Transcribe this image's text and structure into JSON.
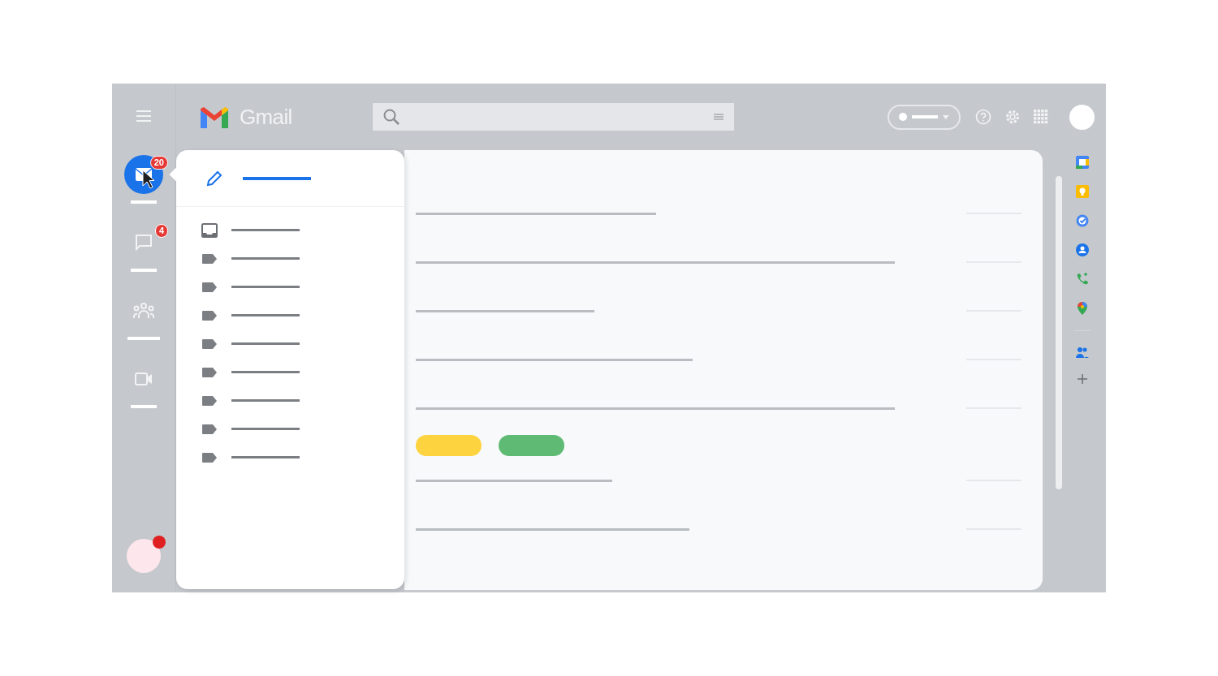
{
  "header": {
    "title": "Gmail"
  },
  "rail": [
    {
      "kind": "mail",
      "selected": true,
      "badge": "20"
    },
    {
      "kind": "chat",
      "selected": false,
      "badge": "4"
    },
    {
      "kind": "spaces",
      "selected": false
    },
    {
      "kind": "meet",
      "selected": false
    }
  ],
  "drawer": {
    "items": [
      {
        "kind": "inbox"
      },
      {
        "kind": "label"
      },
      {
        "kind": "label"
      },
      {
        "kind": "label"
      },
      {
        "kind": "label"
      },
      {
        "kind": "label"
      },
      {
        "kind": "label"
      },
      {
        "kind": "label"
      },
      {
        "kind": "label"
      }
    ]
  },
  "mail_rows": [
    {
      "kind": "line"
    },
    {
      "kind": "line"
    },
    {
      "kind": "line"
    },
    {
      "kind": "line"
    },
    {
      "kind": "line"
    },
    {
      "kind": "tags",
      "tags": [
        {
          "color": "#fdd33f"
        },
        {
          "color": "#5fbb74"
        }
      ]
    },
    {
      "kind": "line"
    },
    {
      "kind": "line"
    }
  ],
  "side_panel": [
    {
      "kind": "calendar"
    },
    {
      "kind": "keep"
    },
    {
      "kind": "tasks"
    },
    {
      "kind": "contacts"
    },
    {
      "kind": "phone"
    },
    {
      "kind": "maps"
    },
    {
      "kind": "divider"
    },
    {
      "kind": "people"
    },
    {
      "kind": "add"
    }
  ]
}
